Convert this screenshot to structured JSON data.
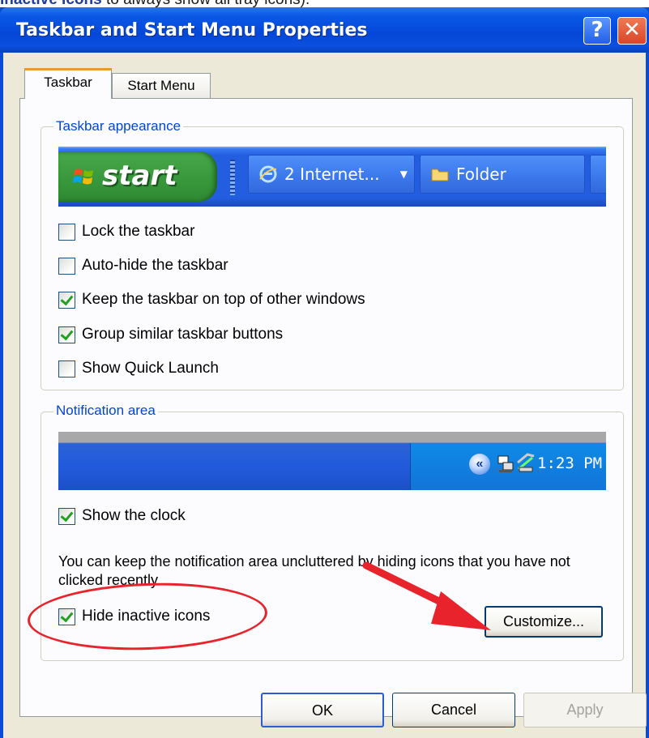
{
  "top_caption": {
    "prefix": "",
    "bold": "Inactive Icons",
    "suffix": " to always show all tray icons)."
  },
  "window": {
    "title": "Taskbar and Start Menu Properties",
    "help_label": "?",
    "close_label": "✕"
  },
  "tabs": [
    {
      "label": "Taskbar",
      "selected": true
    },
    {
      "label": "Start Menu",
      "selected": false
    }
  ],
  "taskbar_appearance": {
    "legend": "Taskbar appearance",
    "preview": {
      "start_label": "start",
      "ie_button": "2 Internet...",
      "folder_button": "Folder"
    },
    "options": [
      {
        "label": "Lock the taskbar",
        "checked": false
      },
      {
        "label": "Auto-hide the taskbar",
        "checked": false
      },
      {
        "label": "Keep the taskbar on top of other windows",
        "checked": true
      },
      {
        "label": "Group similar taskbar buttons",
        "checked": true
      },
      {
        "label": "Show Quick Launch",
        "checked": false
      }
    ]
  },
  "notification_area": {
    "legend": "Notification area",
    "preview": {
      "clock": "1:23 PM"
    },
    "show_clock": {
      "label": "Show the clock",
      "checked": true
    },
    "info": "You can keep the notification area uncluttered by hiding icons that you have not clicked recently.",
    "hide_inactive": {
      "label": "Hide inactive icons",
      "checked": true
    },
    "customize_label": "Customize..."
  },
  "buttons": {
    "ok": "OK",
    "cancel": "Cancel",
    "apply": "Apply",
    "apply_enabled": false
  },
  "annotation_color": "#e8232b"
}
